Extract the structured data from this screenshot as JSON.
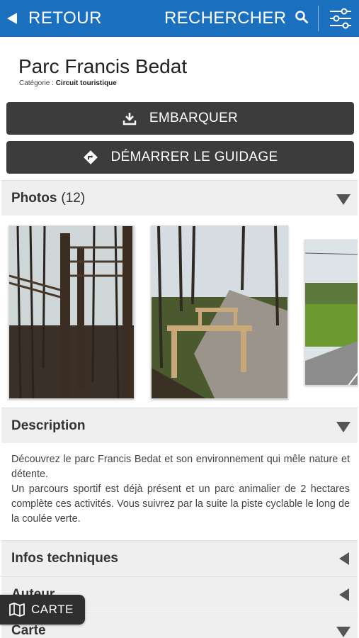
{
  "topbar": {
    "back_label": "RETOUR",
    "search_label": "RECHERCHER",
    "back_icon": "back-triangle-icon",
    "search_icon": "search-icon",
    "filter_icon": "filters-icon",
    "background": "#1b6fbf"
  },
  "poi": {
    "title": "Parc Francis Bedat",
    "category_label": "Catégorie :",
    "category_value": "Circuit touristique"
  },
  "actions": {
    "embark_label": "EMBARQUER",
    "embark_icon": "download-icon",
    "guide_label": "DÉMARRER LE GUIDAGE",
    "guide_icon": "direction-icon",
    "button_color": "#3c3c3c"
  },
  "sections": {
    "photos": {
      "title": "Photos",
      "count": "(12)"
    },
    "description": {
      "title": "Description"
    },
    "infos": {
      "title": "Infos techniques"
    },
    "auteur": {
      "title": "Auteur"
    },
    "carte": {
      "title": "Carte"
    }
  },
  "photos": [
    {
      "subject": "wooden obstacle course in forest"
    },
    {
      "subject": "wooden bars beside path in woods"
    },
    {
      "subject": "bike path along green field"
    }
  ],
  "description": {
    "paragraph_1": "Découvrez le parc Francis Bedat et son environnement qui mêle nature et détente.",
    "paragraph_2": "Un parcours sportif est déjà présent et un parc animalier de 2 hectares complète ces activités. Vous suivrez par la suite la piste cyclable le long de la coulée verte."
  },
  "floating": {
    "map_label": "CARTE",
    "map_icon": "map-icon"
  }
}
